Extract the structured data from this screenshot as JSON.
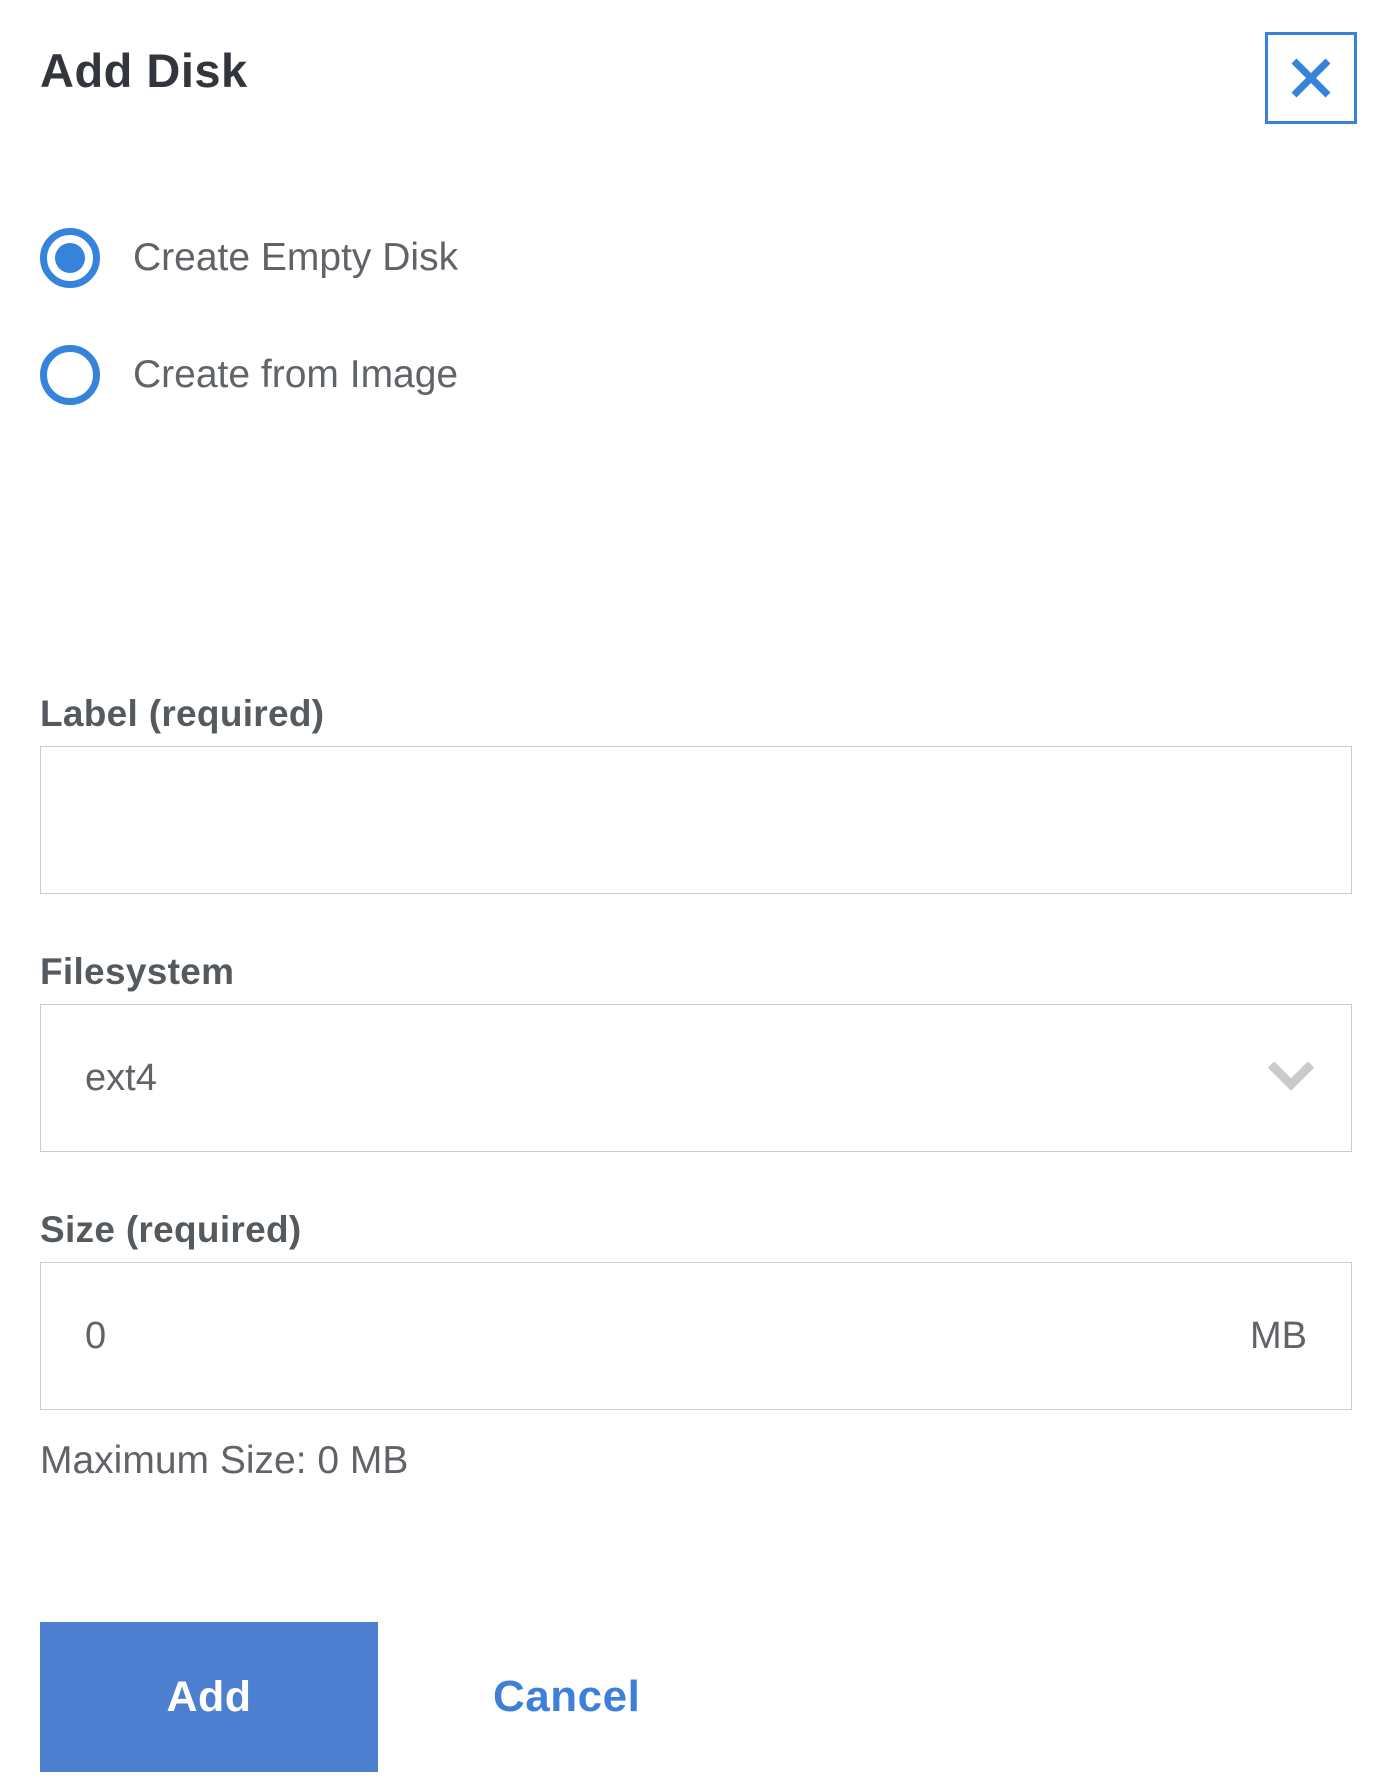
{
  "dialog": {
    "title": "Add Disk"
  },
  "mode": {
    "options": [
      {
        "label": "Create Empty Disk",
        "selected": true
      },
      {
        "label": "Create from Image",
        "selected": false
      }
    ]
  },
  "fields": {
    "label": {
      "label": "Label (required)",
      "value": "",
      "placeholder": ""
    },
    "filesystem": {
      "label": "Filesystem",
      "value": "ext4"
    },
    "size": {
      "label": "Size (required)",
      "value": "0",
      "unit": "MB",
      "helper": "Maximum Size: 0 MB"
    }
  },
  "actions": {
    "add": "Add",
    "cancel": "Cancel"
  },
  "icons": {
    "close": "close-icon",
    "chevron": "chevron-down-icon"
  },
  "colors": {
    "accent_blue": "#3683dc",
    "button_blue": "#4d7fd1",
    "title_text": "#32363c",
    "body_text": "#606469",
    "label_text": "#555a5f",
    "input_border": "#cccccc"
  }
}
